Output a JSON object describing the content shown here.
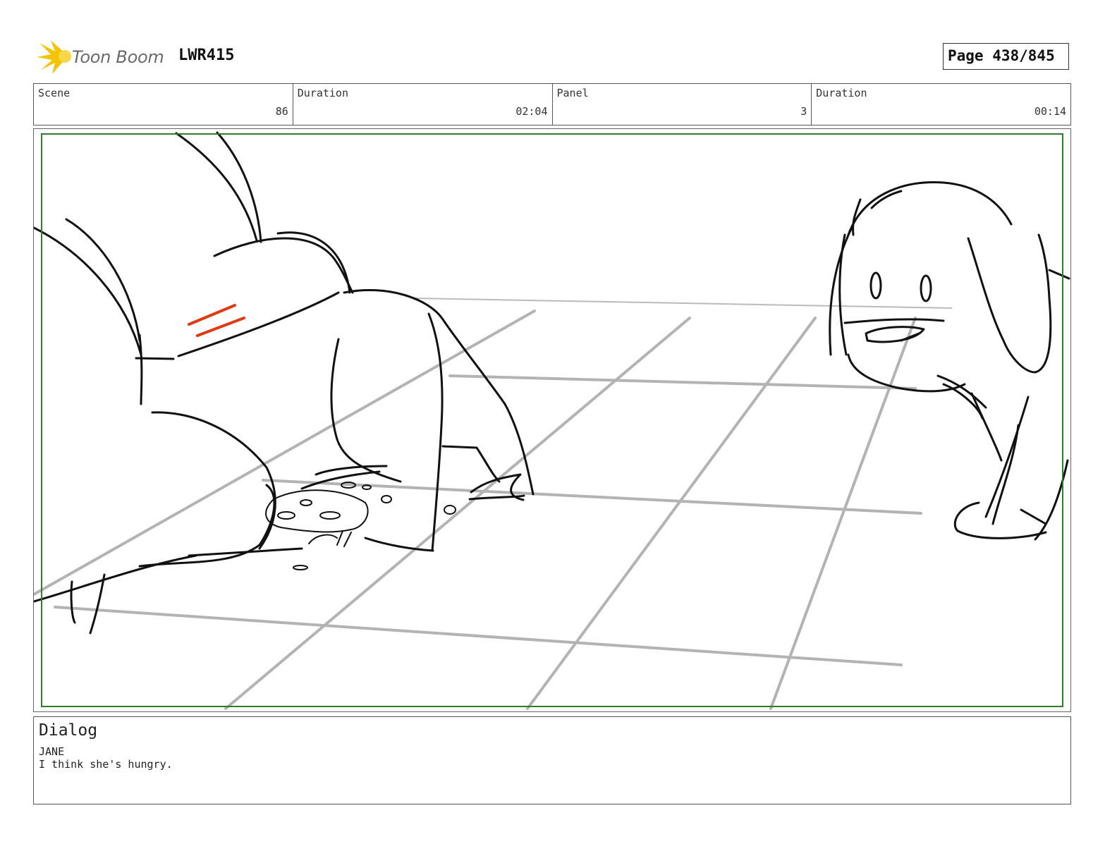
{
  "header": {
    "logo_text": "Toon Boom",
    "project_code": "LWR415",
    "page_label": "Page 438/845"
  },
  "info": {
    "scene_label": "Scene",
    "scene_value": "86",
    "duration_label": "Duration",
    "duration_value": "02:04",
    "panel_label": "Panel",
    "panel_value": "3",
    "panel_duration_label": "Duration",
    "panel_duration_value": "00:14"
  },
  "dialog": {
    "title": "Dialog",
    "speaker": "JANE",
    "line": "I think she's hungry."
  },
  "colors": {
    "logo_star": "#f4c400",
    "frame_guide": "#2e7d2e",
    "sketch_ink": "#111111",
    "floor_lines": "#b0b0b0",
    "accent_marks": "#e03a12"
  }
}
